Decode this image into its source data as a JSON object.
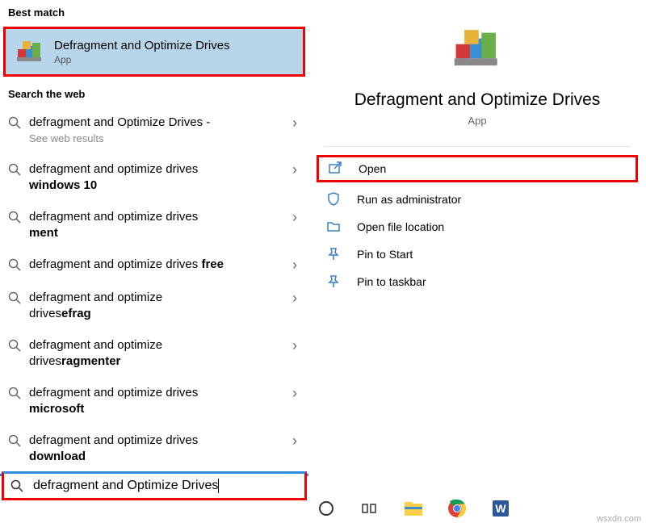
{
  "left": {
    "best_match_header": "Best match",
    "best_match": {
      "title": "Defragment and Optimize Drives",
      "subtitle": "App"
    },
    "web_header": "Search the web",
    "results": [
      {
        "line1": "defragment and Optimize Drives -",
        "line2": "",
        "sub": "See web results"
      },
      {
        "line1": "defragment and optimize drives",
        "line2": "windows 10",
        "bold2": true
      },
      {
        "line1": "defragment and optimize drives",
        "line2": "ment",
        "bold2": true
      },
      {
        "line1": "defragment and optimize drives ",
        "line1b": "free",
        "inline_bold": true
      },
      {
        "line1": "defragment and optimize",
        "line2pre": "drives",
        "line2": "efrag",
        "bold2": true
      },
      {
        "line1": "defragment and optimize",
        "line2pre": "drives",
        "line2": "ragmenter",
        "bold2": true
      },
      {
        "line1": "defragment and optimize drives",
        "line2": "microsoft",
        "bold2": true
      },
      {
        "line1": "defragment and optimize drives",
        "line2": "download",
        "bold2": true
      }
    ],
    "search_value": "defragment and Optimize Drives"
  },
  "right": {
    "title": "Defragment and Optimize Drives",
    "subtitle": "App",
    "actions": [
      {
        "name": "open",
        "label": "Open",
        "icon": "open-icon",
        "highlight": true
      },
      {
        "name": "run-admin",
        "label": "Run as administrator",
        "icon": "shield-icon"
      },
      {
        "name": "file-loc",
        "label": "Open file location",
        "icon": "folder-icon"
      },
      {
        "name": "pin-start",
        "label": "Pin to Start",
        "icon": "pin-icon"
      },
      {
        "name": "pin-taskbar",
        "label": "Pin to taskbar",
        "icon": "pin-icon"
      }
    ]
  },
  "watermark": "wsxdn.com"
}
